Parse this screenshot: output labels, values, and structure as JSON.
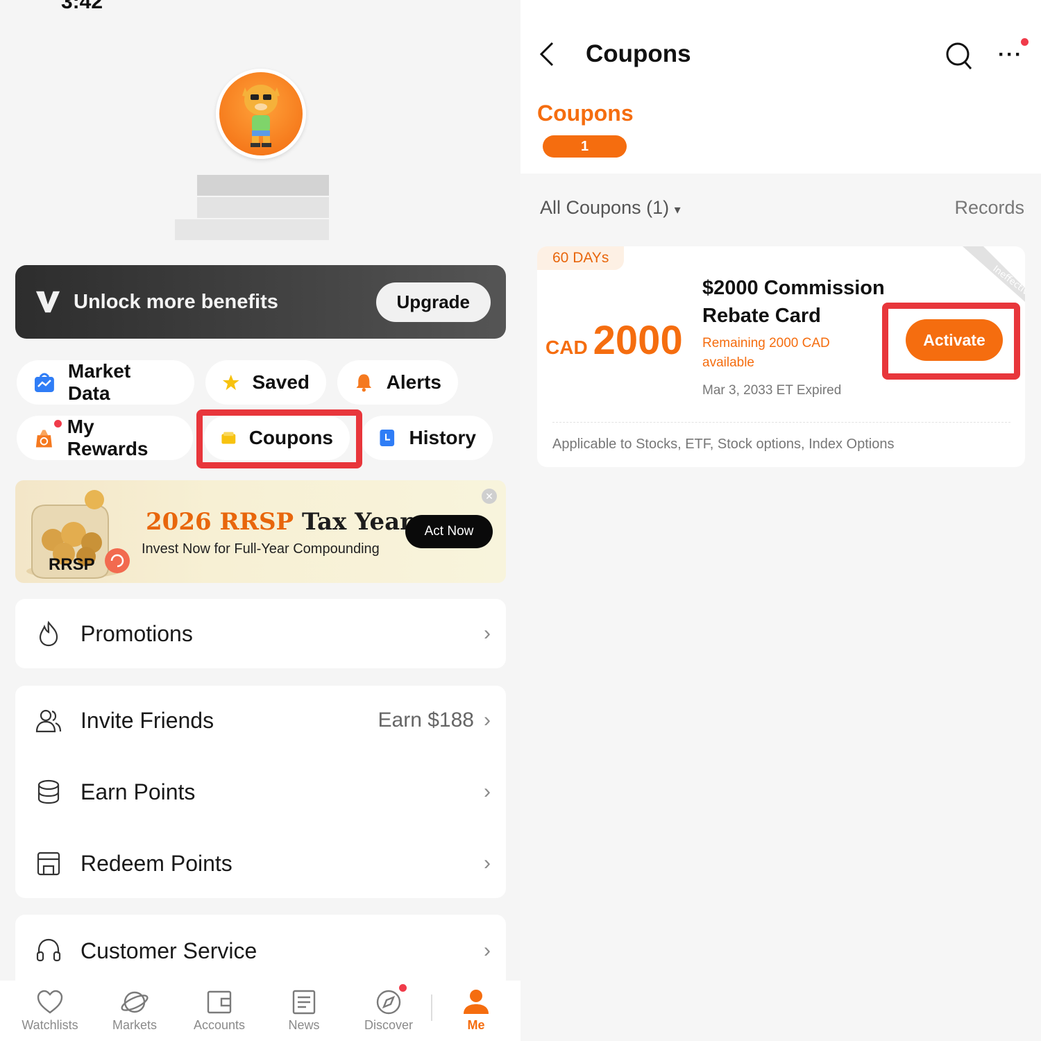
{
  "left_screen": {
    "status_time_fragment": "3:42",
    "vip": {
      "text": "Unlock more benefits",
      "button": "Upgrade"
    },
    "shortcuts": [
      {
        "label": "Market Data",
        "icon": "market-data-icon"
      },
      {
        "label": "Saved",
        "icon": "star-icon"
      },
      {
        "label": "Alerts",
        "icon": "bell-icon"
      },
      {
        "label": "My Rewards",
        "icon": "rewards-icon"
      },
      {
        "label": "Coupons",
        "icon": "coupon-wallet-icon"
      },
      {
        "label": "History",
        "icon": "history-icon"
      }
    ],
    "banner": {
      "title_year": "2026 RRSP",
      "title_rest": "Tax Year",
      "subtitle": "Invest Now for Full-Year Compounding",
      "image_label": "RRSP",
      "cta": "Act Now"
    },
    "menu": {
      "promotions": {
        "label": "Promotions"
      },
      "invite": {
        "label": "Invite Friends",
        "extra": "Earn $188"
      },
      "earn_points": {
        "label": "Earn Points"
      },
      "redeem_points": {
        "label": "Redeem Points"
      },
      "customer_service": {
        "label": "Customer Service"
      }
    },
    "tabbar": [
      {
        "label": "Watchlists",
        "icon": "heart-icon"
      },
      {
        "label": "Markets",
        "icon": "planet-icon"
      },
      {
        "label": "Accounts",
        "icon": "wallet-icon"
      },
      {
        "label": "News",
        "icon": "news-icon"
      },
      {
        "label": "Discover",
        "icon": "compass-icon"
      },
      {
        "label": "Me",
        "icon": "person-icon",
        "active": true
      }
    ]
  },
  "right_screen": {
    "header": {
      "title": "Coupons"
    },
    "tab": {
      "label": "Coupons",
      "count": "1"
    },
    "filter": {
      "label": "All Coupons (1)",
      "records": "Records"
    },
    "coupon": {
      "duration": "60 DAYs",
      "status_ribbon": "Ineffective",
      "currency": "CAD",
      "amount": "2000",
      "title": "$2000 Commission Rebate Card",
      "remaining": "Remaining 2000 CAD available",
      "expiry": "Mar 3, 2033 ET Expired",
      "button": "Activate",
      "applicable": "Applicable to Stocks, ETF, Stock options, Index Options"
    }
  },
  "colors": {
    "accent": "#f56d0f",
    "highlight": "#e8363b",
    "dark_banner": "#2d2d2d"
  }
}
